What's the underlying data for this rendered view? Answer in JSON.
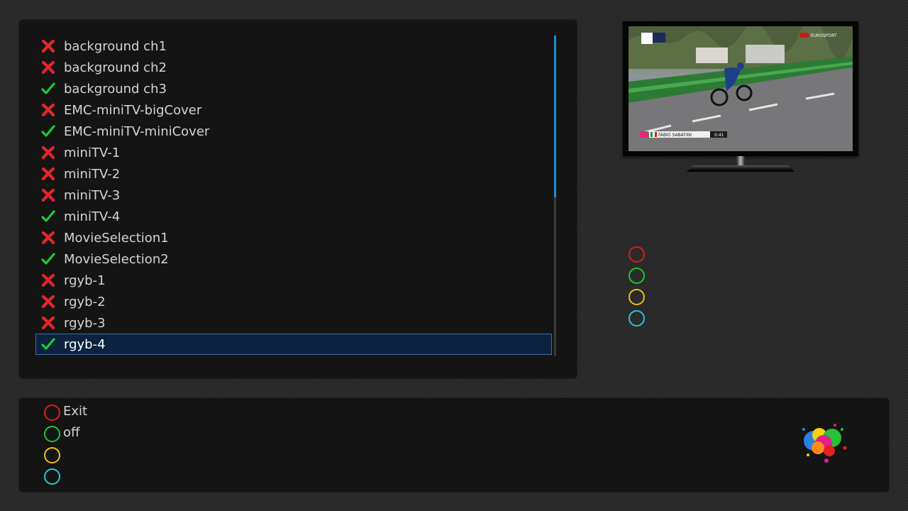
{
  "skins": {
    "items": [
      {
        "label": "background ch1",
        "enabled": false
      },
      {
        "label": "background ch2",
        "enabled": false
      },
      {
        "label": "background ch3",
        "enabled": true
      },
      {
        "label": "EMC-miniTV-bigCover",
        "enabled": false
      },
      {
        "label": "EMC-miniTV-miniCover",
        "enabled": true
      },
      {
        "label": "miniTV-1",
        "enabled": false
      },
      {
        "label": "miniTV-2",
        "enabled": false
      },
      {
        "label": "miniTV-3",
        "enabled": false
      },
      {
        "label": "miniTV-4",
        "enabled": true
      },
      {
        "label": "MovieSelection1",
        "enabled": false
      },
      {
        "label": "MovieSelection2",
        "enabled": true
      },
      {
        "label": "rgyb-1",
        "enabled": false
      },
      {
        "label": "rgyb-2",
        "enabled": false
      },
      {
        "label": "rgyb-3",
        "enabled": false
      },
      {
        "label": "rgyb-4",
        "enabled": true
      }
    ],
    "selected_index": 14
  },
  "icons": {
    "enabled": "check-icon",
    "disabled": "cross-icon"
  },
  "buttons": {
    "red": "Exit",
    "green": "off",
    "yellow": "",
    "blue": ""
  },
  "tv_preview": {
    "channel_logo": "EUROSPORT",
    "rider_name": "FABIO SABATINI",
    "timer": "0:41"
  },
  "colors": {
    "red": "#e01b1b",
    "green": "#1fc42c",
    "yellow": "#e8c21a",
    "blue": "#2ac4d8",
    "check": "#22c93a",
    "cross": "#e3262c",
    "selection_bg": "#0c2340",
    "selection_border": "#3c6f9e",
    "scroll_thumb": "#1b8fd6"
  }
}
